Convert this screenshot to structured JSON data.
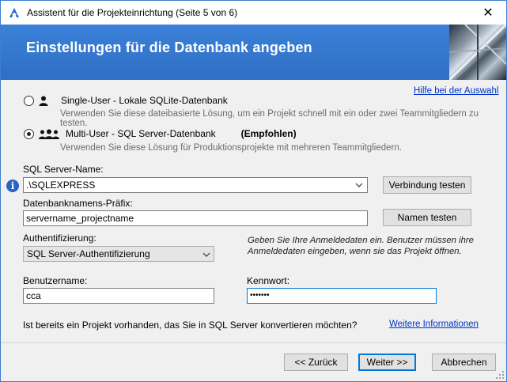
{
  "window": {
    "title": "Assistent für die Projekteinrichtung (Seite 5 von 6)",
    "close_glyph": "✕"
  },
  "banner": {
    "title": "Einstellungen für die Datenbank angeben"
  },
  "help_link": "Hilfe bei der Auswahl",
  "single_user": {
    "label": "Single-User - Lokale SQLite-Datenbank",
    "description": "Verwenden Sie diese dateibasierte Lösung, um ein Projekt schnell mit ein oder zwei Teammitgliedern zu testen.",
    "selected": false
  },
  "multi_user": {
    "label": "Multi-User - SQL Server-Datenbank",
    "badge": "(Empfohlen)",
    "description": "Verwenden Sie diese Lösung für Produktionsprojekte mit mehreren Teammitgliedern.",
    "selected": true
  },
  "sql_server": {
    "label": "SQL Server-Name:",
    "value": ".\\SQLEXPRESS",
    "test_button": "Verbindung testen"
  },
  "db_prefix": {
    "label": "Datenbanknamens-Präfix:",
    "value": "servername_projectname",
    "test_button": "Namen testen"
  },
  "auth": {
    "label": "Authentifizierung:",
    "value": "SQL Server-Authentifizierung",
    "hint": "Geben Sie Ihre Anmeldedaten ein. Benutzer müssen ihre Anmeldedaten eingeben, wenn sie das Projekt öffnen."
  },
  "username": {
    "label": "Benutzername:",
    "value": "cca"
  },
  "password": {
    "label": "Kennwort:",
    "value": "•••••••"
  },
  "convert": {
    "question": "Ist bereits ein Projekt vorhanden, das Sie in SQL Server konvertieren möchten?",
    "link": "Weitere Informationen"
  },
  "footer": {
    "back": "<< Zurück",
    "next": "Weiter >>",
    "cancel": "Abbrechen"
  },
  "colors": {
    "banner": "#3b82d8",
    "link": "#0033cc",
    "accent": "#0078d7"
  },
  "icons": {
    "app": "autodesk-a-icon",
    "info": "info-icon",
    "single_user": "single-user-icon",
    "multi_user": "multi-user-icon",
    "dropdown": "chevron-down-icon"
  }
}
